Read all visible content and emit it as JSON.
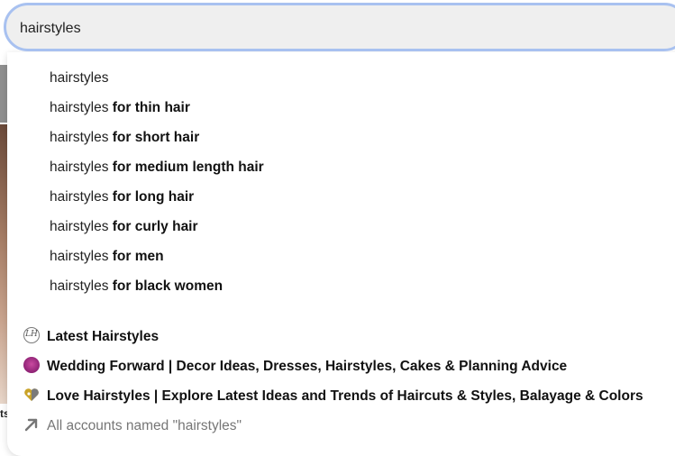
{
  "search": {
    "value": "hairstyles"
  },
  "suggestions": [
    {
      "prefix": "hairstyles",
      "completion": ""
    },
    {
      "prefix": "hairstyles",
      "completion": " for thin hair"
    },
    {
      "prefix": "hairstyles",
      "completion": " for short hair"
    },
    {
      "prefix": "hairstyles",
      "completion": " for medium length hair"
    },
    {
      "prefix": "hairstyles",
      "completion": " for long hair"
    },
    {
      "prefix": "hairstyles",
      "completion": " for curly hair"
    },
    {
      "prefix": "hairstyles",
      "completion": " for men"
    },
    {
      "prefix": "hairstyles",
      "completion": " for black women"
    }
  ],
  "accounts": [
    {
      "name": "Latest Hairstyles",
      "icon": "latest-hairstyles-logo-icon"
    },
    {
      "name": "Wedding Forward | Decor Ideas, Dresses, Hairstyles, Cakes & Planning Advice",
      "icon": "wedding-forward-logo-icon"
    },
    {
      "name": "Love Hairstyles | Explore Latest Ideas and Trends of Haircuts & Styles, Balayage & Colors",
      "icon": "love-hairstyles-logo-icon"
    }
  ],
  "all_accounts": {
    "label": "All accounts named \"hairstyles\"",
    "icon": "arrow-up-right-icon"
  },
  "background": {
    "fragment_text": "ts"
  },
  "colors": {
    "search_border": "#a8c1f0",
    "search_bg": "#efefef",
    "muted_text": "#767676"
  }
}
